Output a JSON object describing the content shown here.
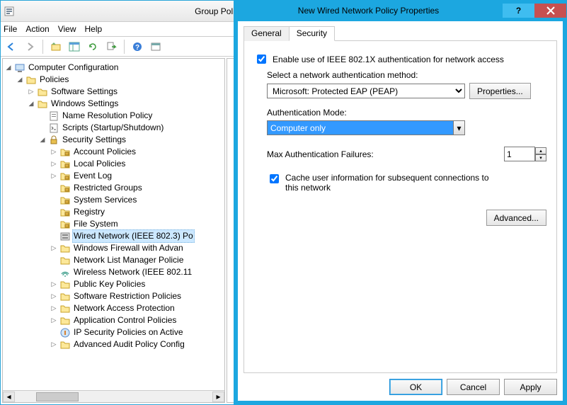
{
  "window": {
    "title": "Group Policy Management Editor"
  },
  "menu": {
    "file": "File",
    "action": "Action",
    "view": "View",
    "help": "Help"
  },
  "tree": {
    "root": "Computer Configuration",
    "policies": "Policies",
    "software": "Software Settings",
    "windows": "Windows Settings",
    "nameres": "Name Resolution Policy",
    "scripts": "Scripts (Startup/Shutdown)",
    "security": "Security Settings",
    "account": "Account Policies",
    "local": "Local Policies",
    "eventlog": "Event Log",
    "restricted": "Restricted Groups",
    "system": "System Services",
    "registry": "Registry",
    "filesystem": "File System",
    "wired": "Wired Network (IEEE 802.3) Po",
    "firewall": "Windows Firewall with Advan",
    "netlist": "Network List Manager Policie",
    "wireless": "Wireless Network (IEEE 802.11",
    "pubkey": "Public Key Policies",
    "softrest": "Software Restriction Policies",
    "nap": "Network Access Protection",
    "appctrl": "Application Control Policies",
    "ipsec": "IP Security Policies on Active",
    "audit": "Advanced Audit Policy Config"
  },
  "dialog": {
    "title": "New Wired Network Policy Properties",
    "tabs": {
      "general": "General",
      "security": "Security"
    },
    "enable_8021x": "Enable use of IEEE 802.1X authentication for network access",
    "select_method_label": "Select a network authentication method:",
    "method": "Microsoft: Protected EAP (PEAP)",
    "properties_btn": "Properties...",
    "auth_mode_label": "Authentication Mode:",
    "auth_mode": "Computer only",
    "max_failures_label": "Max Authentication Failures:",
    "max_failures": "1",
    "cache_label": "Cache user information for subsequent connections to this network",
    "advanced_btn": "Advanced...",
    "ok": "OK",
    "cancel": "Cancel",
    "apply": "Apply"
  }
}
